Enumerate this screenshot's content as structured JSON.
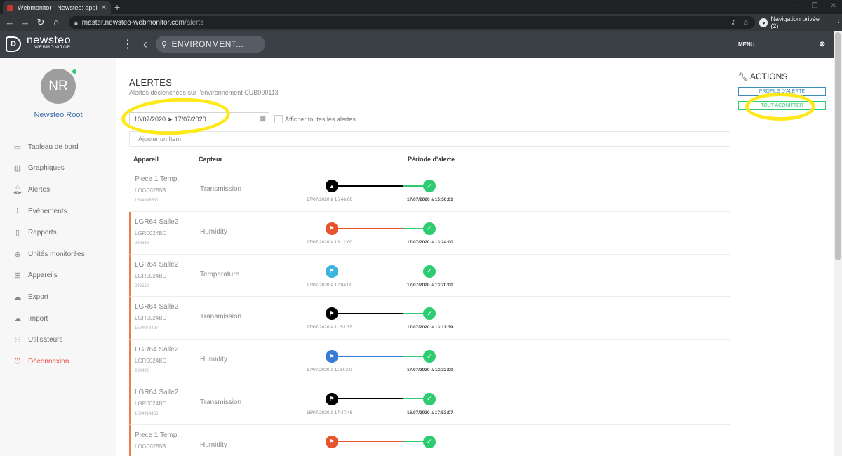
{
  "browser": {
    "tab_title": "Webmonitor - Newsteo: applicat",
    "url_host": "master.newsteo-webmonitor.com",
    "url_path": "/alerts",
    "private_label": "Navigation privée (2)"
  },
  "app": {
    "logo_text": "newsteo",
    "logo_sub": "WEBMONITOR",
    "environment": "ENVIRONMENT..."
  },
  "user": {
    "initials": "NR",
    "name": "Newsteo Root"
  },
  "sidebar": {
    "items": [
      {
        "label": "Tableau de bord",
        "icon": "monitor-icon"
      },
      {
        "label": "Graphiques",
        "icon": "bar-chart-icon"
      },
      {
        "label": "Alertes",
        "icon": "bell-icon"
      },
      {
        "label": "Evènements",
        "icon": "paperclip-icon"
      },
      {
        "label": "Rapports",
        "icon": "document-icon"
      },
      {
        "label": "Unités monitorées",
        "icon": "crosshair-icon"
      },
      {
        "label": "Appareils",
        "icon": "grid-icon"
      },
      {
        "label": "Export",
        "icon": "cloud-upload-icon"
      },
      {
        "label": "Import",
        "icon": "cloud-download-icon"
      },
      {
        "label": "Utilisateurs",
        "icon": "user-icon"
      },
      {
        "label": "Déconnexion",
        "icon": "power-icon"
      }
    ]
  },
  "page": {
    "title": "ALERTES",
    "subtitle": "Alertes déclenchées sur l'environnement CUB000113",
    "date_range": "10/07/2020 ➤ 17/07/2020",
    "show_all_label": "Afficher toutes les alertes",
    "add_item_label": "Ajouter un Item"
  },
  "table": {
    "headers": {
      "device": "Appareil",
      "sensor": "Capteur",
      "period": "Période d'alerte"
    },
    "rows": [
      {
        "device": "Piece 1 Temp.",
        "log": "LOG00255B",
        "serial": "1594993560",
        "sensor": "Transmission",
        "start": "17/07/2020 à 15:46:00",
        "end": "17/07/2020 à 15:50:01",
        "color": "#000000",
        "icon": "bell-icon"
      },
      {
        "device": "LGR64 Salle2",
        "log": "LGR0024BD",
        "serial": "239632",
        "sensor": "Humidity",
        "start": "17/07/2020 à 13:12:00",
        "end": "17/07/2020 à 13:24:00",
        "color": "#e8542d",
        "icon": "flag-icon"
      },
      {
        "device": "LGR64 Salle2",
        "log": "LGR0024BD",
        "serial": "239512",
        "sensor": "Temperature",
        "start": "17/07/2020 à 12:04:00",
        "end": "17/07/2020 à 13:20:00",
        "color": "#3bb5e0",
        "icon": "flag-icon"
      },
      {
        "device": "LGR64 Salle2",
        "log": "LGR0024BD",
        "serial": "1594979497",
        "sensor": "Transmission",
        "start": "17/07/2020 à 11:51:37",
        "end": "17/07/2020 à 13:11:39",
        "color": "#000000",
        "icon": "flag-icon"
      },
      {
        "device": "LGR64 Salle2",
        "log": "LGR0024BD",
        "serial": "239492",
        "sensor": "Humidity",
        "start": "17/07/2020 à 11:50:00",
        "end": "17/07/2020 à 12:32:00",
        "color": "#3a7bd5",
        "icon": "flag-icon"
      },
      {
        "device": "LGR64 Salle2",
        "log": "LGR0024BD",
        "serial": "1594914466",
        "sensor": "Transmission",
        "start": "16/07/2020 à 17:47:46",
        "end": "16/07/2020 à 17:53:07",
        "color": "#000000",
        "icon": "flag-icon"
      },
      {
        "device": "Piece 1 Temp.",
        "log": "LOG00255B",
        "serial": "",
        "sensor": "Humidity",
        "start": "",
        "end": "",
        "color": "#e8542d",
        "icon": "flag-icon"
      }
    ]
  },
  "menu": {
    "title": "MENU",
    "actions_title": "ACTIONS",
    "profils_label": "PROFILS D'ALERTE",
    "acquit_label": "TOUT ACQUITTER"
  }
}
